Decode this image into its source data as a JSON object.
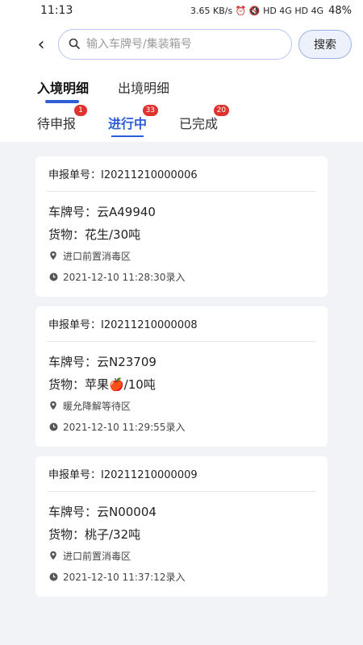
{
  "status_bar": {
    "time": "11:13",
    "icons": "3.65 KB/s  ⏰ 🔇 HD 4G  HD 4G",
    "battery": "48%"
  },
  "search": {
    "placeholder": "输入车牌号/集装箱号",
    "button_label": "搜索"
  },
  "direction_tabs": [
    {
      "label": "入境明细",
      "active": true
    },
    {
      "label": "出境明细",
      "active": false
    }
  ],
  "status_tabs": [
    {
      "label": "待申报",
      "badge": "1",
      "active": false
    },
    {
      "label": "进行中",
      "badge": "33",
      "active": true
    },
    {
      "label": "已完成",
      "badge": "20",
      "active": false
    }
  ],
  "cards": [
    {
      "declaration": "申报单号：I20211210000006",
      "plate": "车牌号：云A49940",
      "goods": "货物：花生/30吨",
      "location": "进口前置消毒区",
      "time": "2021-12-10 11:28:30录入"
    },
    {
      "declaration": "申报单号：I20211210000008",
      "plate": "车牌号：云N23709",
      "goods": "货物：苹果🍎/10吨",
      "location": "暖允降解等待区",
      "time": "2021-12-10 11:29:55录入"
    },
    {
      "declaration": "申报单号：I20211210000009",
      "plate": "车牌号：云N00004",
      "goods": "货物：桃子/32吨",
      "location": "进口前置消毒区",
      "time": "2021-12-10 11:37:12录入"
    }
  ]
}
